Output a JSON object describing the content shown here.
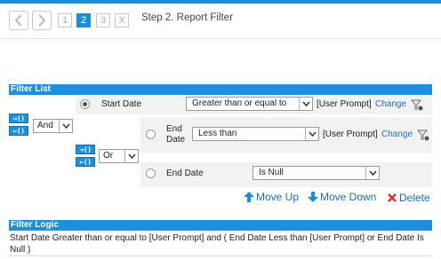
{
  "wizard": {
    "steps": [
      "1",
      "2",
      "3",
      "X"
    ],
    "active_step": "2",
    "title": "Step 2. Report Filter"
  },
  "filter_list": {
    "header": "Filter List",
    "conditions": [
      {
        "field": "Start Date",
        "operator": "Greater than or equal to",
        "value": "[User Prompt]",
        "change_label": "Change",
        "selected": true
      },
      {
        "field": "End Date",
        "operator": "Less than",
        "value": "[User Prompt]",
        "change_label": "Change",
        "selected": false
      },
      {
        "field": "End Date",
        "operator": "Is Null",
        "selected": false
      }
    ],
    "connectors": {
      "outer": "And",
      "inner": "Or"
    },
    "group_icons": {
      "indent": "→()",
      "outdent": "←()"
    },
    "actions": {
      "move_up": "Move Up",
      "move_down": "Move Down",
      "delete": "Delete"
    }
  },
  "filter_logic": {
    "header": "Filter Logic",
    "text": "Start Date Greater than or equal to [User Prompt] and ( End Date Less than [User Prompt]   or End Date Is Null )"
  },
  "colors": {
    "accent": "#1e8ede",
    "link": "#1b6fc2",
    "delete": "#d9342b",
    "row_bg": "#f2f2f2"
  },
  "icons": [
    "back-icon",
    "forward-icon",
    "filter-funnel-icon",
    "arrow-up-icon",
    "arrow-down-icon",
    "delete-x-icon"
  ]
}
